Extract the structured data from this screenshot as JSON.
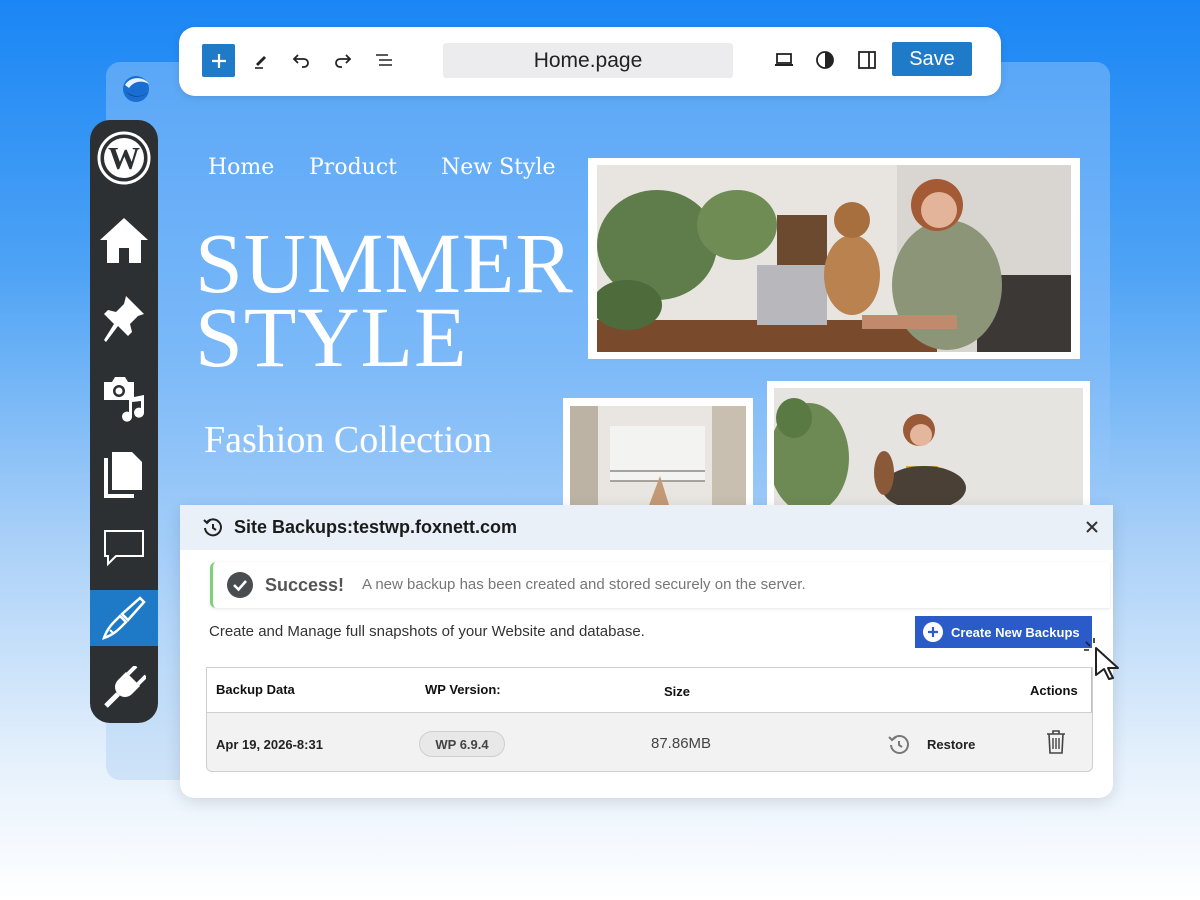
{
  "toolbar": {
    "page_name": "Home.page",
    "save_label": "Save"
  },
  "site_nav": [
    "Home",
    "Product",
    "New Style"
  ],
  "hero": {
    "title_line1": "SUMMER",
    "title_line2": "STYLE",
    "subtitle": "Fashion Collection"
  },
  "backups": {
    "title": "Site Backups:testwp.foxnett.com",
    "success_title": "Success!",
    "success_message": "A new backup has been created and stored securely on the server.",
    "description": "Create and Manage full snapshots of your Website and database.",
    "create_button": "Create New Backups",
    "columns": [
      "Backup Data",
      "WP Version:",
      "Size",
      "Actions"
    ],
    "rows": [
      {
        "date": "Apr 19, 2026-8:31",
        "wp_version": "WP 6.9.4",
        "size": "87.86MB",
        "restore_label": "Restore"
      }
    ]
  },
  "sidebar": {
    "items": [
      "wordpress-logo-icon",
      "home-icon",
      "pin-icon",
      "media-icon",
      "pages-icon",
      "comments-icon",
      "appearance-icon",
      "plugins-icon"
    ],
    "active_item": "appearance-icon"
  },
  "colors": {
    "accent": "#1f7ac8",
    "create_button": "#2a5bc8",
    "sidebar": "#2c3033",
    "success": "#7fd07a"
  }
}
